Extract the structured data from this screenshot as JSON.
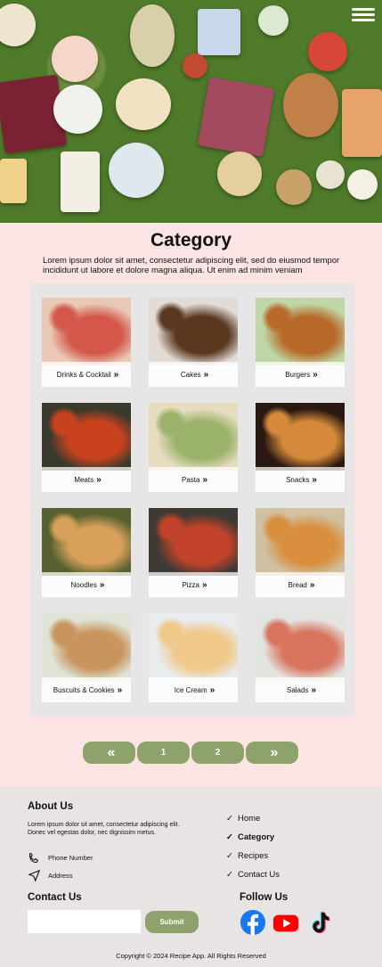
{
  "category": {
    "title": "Category",
    "description": "Lorem ipsum dolor sit amet, consectetur adipiscing elit, sed do eiusmod tempor incididunt ut labore et dolore magna aliqua. Ut enim ad minim veniam"
  },
  "cards": [
    {
      "label": "Drinks & Cocktail",
      "color1": "#e9c9b6",
      "color2": "#d4574a"
    },
    {
      "label": "Cakes",
      "color1": "#e2dbd6",
      "color2": "#5a3820"
    },
    {
      "label": "Burgers",
      "color1": "#bfd7a6",
      "color2": "#b86a2a"
    },
    {
      "label": "Meats",
      "color1": "#3a3a2c",
      "color2": "#c9421e"
    },
    {
      "label": "Pasta",
      "color1": "#e6dcc0",
      "color2": "#9bb26a"
    },
    {
      "label": "Snacks",
      "color1": "#2a1812",
      "color2": "#d48a3a"
    },
    {
      "label": "Noodles",
      "color1": "#56612f",
      "color2": "#d8a05a"
    },
    {
      "label": "Pizza",
      "color1": "#3f3a34",
      "color2": "#c2432a"
    },
    {
      "label": "Bread",
      "color1": "#cfc1a2",
      "color2": "#d98f3e"
    },
    {
      "label": "Buscuits & Cookies",
      "color1": "#dfe4d6",
      "color2": "#c8955e"
    },
    {
      "label": "Ice Cream",
      "color1": "#e8ecef",
      "color2": "#f0c98a"
    },
    {
      "label": "Salads",
      "color1": "#e3e3e0",
      "color2": "#d9745e"
    }
  ],
  "pagination": {
    "prev": "«",
    "pages": [
      "1",
      "2"
    ],
    "next": "»"
  },
  "footer": {
    "about_title": "About Us",
    "about_text": "Lorem ipsum dolor sit amet, consectetur adipiscing elit. Donec vel egestas dolor, nec dignissim metus.",
    "phone": "Phone Number",
    "address": "Address",
    "nav": [
      "Home",
      "Category",
      "Recipes",
      "Contact Us"
    ],
    "active_nav": "Category",
    "contact_title": "Contact Us",
    "email_placeholder": "",
    "submit_label": "Submit",
    "follow_title": "Follow Us",
    "social": [
      "facebook-icon",
      "youtube-icon",
      "tiktok-icon"
    ],
    "copyright": "Copyright © 2024 Recipe App. All Rights Reserved"
  },
  "colors": {
    "accent": "#8ea36b",
    "page_bg": "#fde4e4",
    "footer_bg": "#e8e4e4"
  }
}
